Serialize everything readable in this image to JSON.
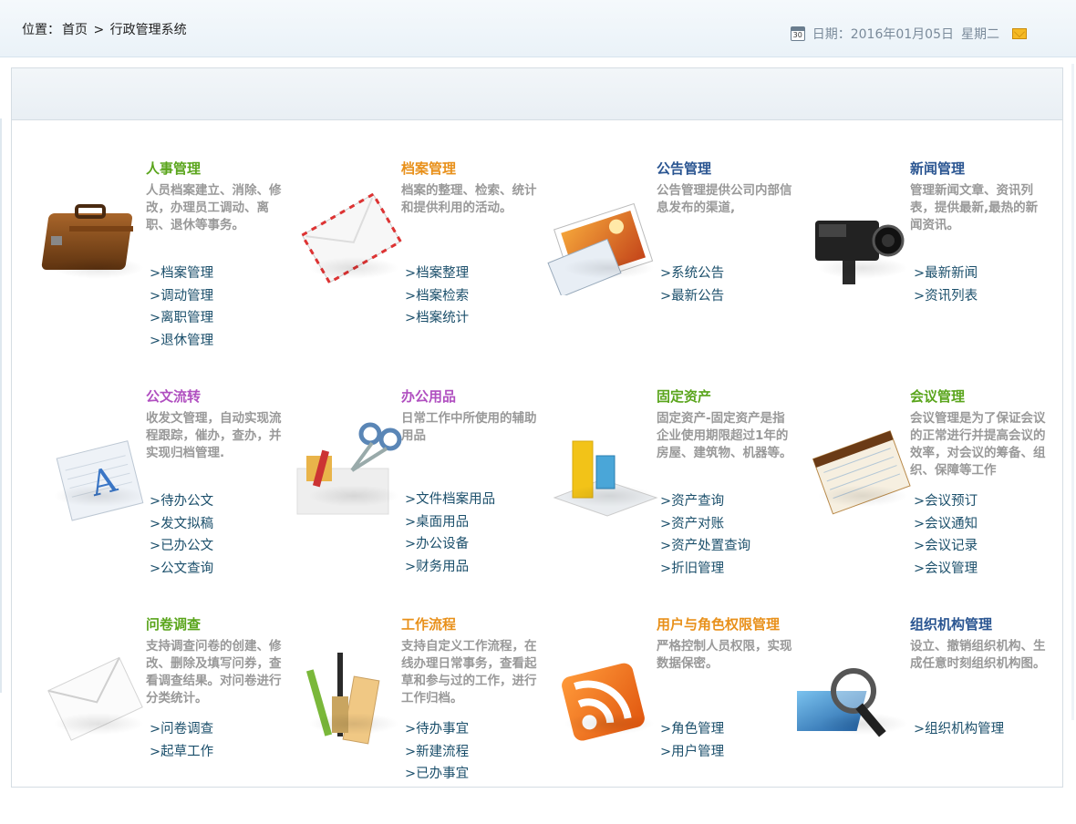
{
  "header": {
    "location_label": "位置：",
    "crumbs": [
      "首页",
      ">",
      "行政管理系统"
    ],
    "calendar_day": "30",
    "date_text": "日期：2016年01月05日",
    "weekday": "星期二"
  },
  "modules": [
    {
      "title": "人事管理",
      "color": "#5aa51c",
      "desc": "人员档案建立、消除、修改，办理员工调动、离职、退休等事务。",
      "links": [
        "档案管理",
        "调动管理",
        "离职管理",
        "退休管理"
      ],
      "icon": "briefcase-icon"
    },
    {
      "title": "档案管理",
      "color": "#e8901a",
      "desc": "档案的整理、检索、统计和提供利用的活动。",
      "links": [
        "档案整理",
        "档案检索",
        "档案统计"
      ],
      "icon": "envelope-icon"
    },
    {
      "title": "公告管理",
      "color": "#2a5591",
      "desc": "公告管理提供公司内部信息发布的渠道,",
      "links": [
        "系统公告",
        "最新公告"
      ],
      "icon": "photo-icon"
    },
    {
      "title": "新闻管理",
      "color": "#2a5591",
      "desc": "管理新闻文章、资讯列表，提供最新,最热的新闻资讯。",
      "links": [
        "最新新闻",
        "资讯列表"
      ],
      "icon": "camera-icon"
    },
    {
      "title": "公文流转",
      "color": "#b04fc0",
      "desc": "收发文管理，自动实现流程跟踪，催办，查办，并实现归档管理.",
      "links": [
        "待办公文",
        "发文拟稿",
        "已办公文",
        "公文查询"
      ],
      "icon": "document-icon"
    },
    {
      "title": "办公用品",
      "color": "#b04fc0",
      "desc": "日常工作中所使用的辅助用品",
      "links": [
        "文件档案用品",
        "桌面用品",
        "办公设备",
        "财务用品"
      ],
      "icon": "scissors-icon"
    },
    {
      "title": "固定资产",
      "color": "#5aa51c",
      "desc": "固定资产-固定资产是指企业使用期限超过1年的房屋、建筑物、机器等。",
      "links": [
        "资产查询",
        "资产对账",
        "资产处置查询",
        "折旧管理"
      ],
      "icon": "bar-chart-icon"
    },
    {
      "title": "会议管理",
      "color": "#5aa51c",
      "desc": "会议管理是为了保证会议的正常进行并提高会议的效率，对会议的筹备、组织、保障等工作",
      "links": [
        "会议预订",
        "会议通知",
        "会议记录",
        "会议管理"
      ],
      "icon": "notepad-icon"
    },
    {
      "title": "问卷调查",
      "color": "#5aa51c",
      "desc": "支持调查问卷的创建、修改、删除及填写问券，查看调查结果。对问卷进行分类统计。",
      "links": [
        "问卷调查",
        "起草工作"
      ],
      "icon": "mail-icon"
    },
    {
      "title": "工作流程",
      "color": "#e8901a",
      "desc": "支持自定义工作流程，在线办理日常事务，查看起草和参与过的工作，进行工作归档。",
      "links": [
        "待办事宜",
        "新建流程",
        "已办事宜"
      ],
      "icon": "pencil-icon"
    },
    {
      "title": "用户与角色权限管理",
      "color": "#e8901a",
      "desc": "严格控制人员权限，实现数据保密。",
      "links": [
        "角色管理",
        "用户管理"
      ],
      "icon": "rss-icon"
    },
    {
      "title": "组织机构管理",
      "color": "#2a5591",
      "desc": "设立、撤销组织机构、生成任意时刻组织机构图。",
      "links": [
        "组织机构管理"
      ],
      "icon": "magnifier-icon"
    }
  ]
}
